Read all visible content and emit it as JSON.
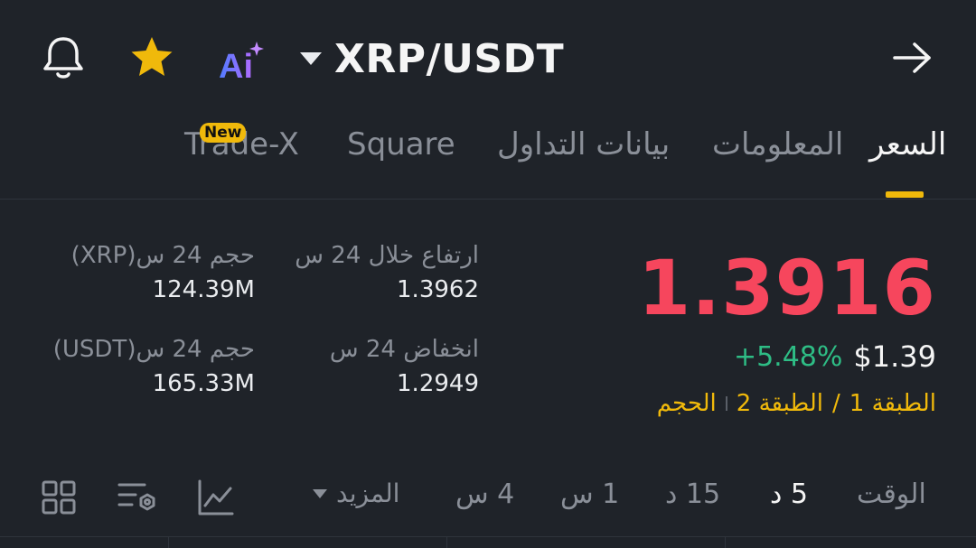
{
  "header": {
    "pair": "XRP/USDT",
    "icons": [
      "bell-icon",
      "star-icon",
      "ai-icon",
      "caret-down-icon",
      "arrow-right-icon"
    ],
    "ai_label": "Ai"
  },
  "tabs": {
    "price": "السعر",
    "info": "المعلومات",
    "trading_data": "بيانات التداول",
    "square": "Square",
    "trade_x": "Trade-X",
    "new_badge": "New"
  },
  "price": {
    "last": "1.3916",
    "usd": "$1.39",
    "change": "+5.48%",
    "layer_1": "الطبقة 1",
    "slash": "/",
    "layer_2": "الطبقة 2",
    "volume_tag": "الحجم"
  },
  "stats": {
    "high_label": "ارتفاع خلال 24 س",
    "high_value": "1.3962",
    "low_label": "انخفاض 24 س",
    "low_value": "1.2949",
    "vol_xrp_label": "حجم 24 س(XRP)",
    "vol_xrp_value": "124.39M",
    "vol_usdt_label": "حجم 24 س(USDT)",
    "vol_usdt_value": "165.33M"
  },
  "timeframes": {
    "time": "الوقت",
    "d5": "5 د",
    "d15": "15 د",
    "h1": "1 س",
    "h4": "4 س",
    "more": "المزيد"
  },
  "colors": {
    "background": "#1f2329",
    "accent": "#f0b90b",
    "down": "#f6465d",
    "up": "#2ebd85"
  }
}
